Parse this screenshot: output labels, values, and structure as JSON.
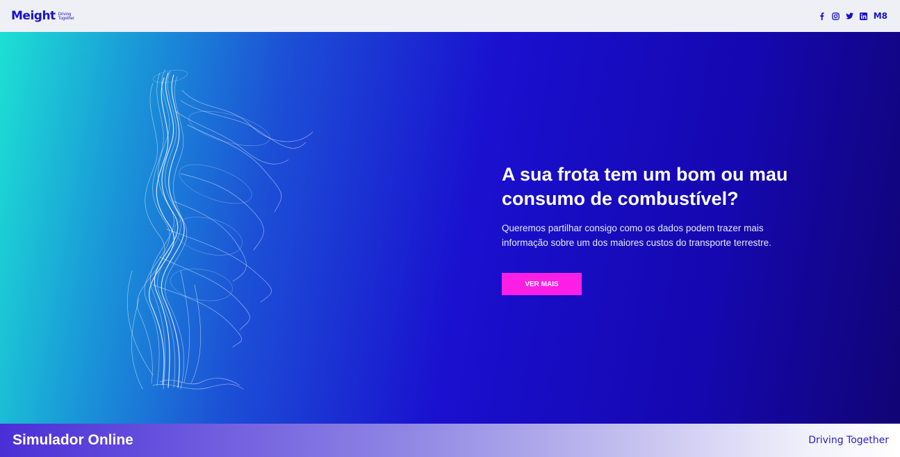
{
  "header": {
    "brand_name": "Meight",
    "brand_tag_line1": "Driving",
    "brand_tag_line2": "Together",
    "social_icons": [
      "facebook-icon",
      "instagram-icon",
      "twitter-icon",
      "linkedin-icon"
    ],
    "m8_label": "M8"
  },
  "hero": {
    "title": "A sua frota tem um bom ou mau consumo de combustível?",
    "subtitle": "Queremos partilhar consigo como os dados podem trazer mais informação sobre um dos maiores custos do transporte terrestre.",
    "cta_label": "VER MAIS",
    "colors": {
      "gradient_start": "#1de0d4",
      "gradient_mid": "#1a10cf",
      "gradient_end": "#110475",
      "cta": "#ff1ee6"
    }
  },
  "footer": {
    "title": "Simulador Online",
    "tagline": "Driving  Together"
  },
  "colors": {
    "brand": "#1a12c8",
    "topbar_bg": "#eef0f5"
  }
}
